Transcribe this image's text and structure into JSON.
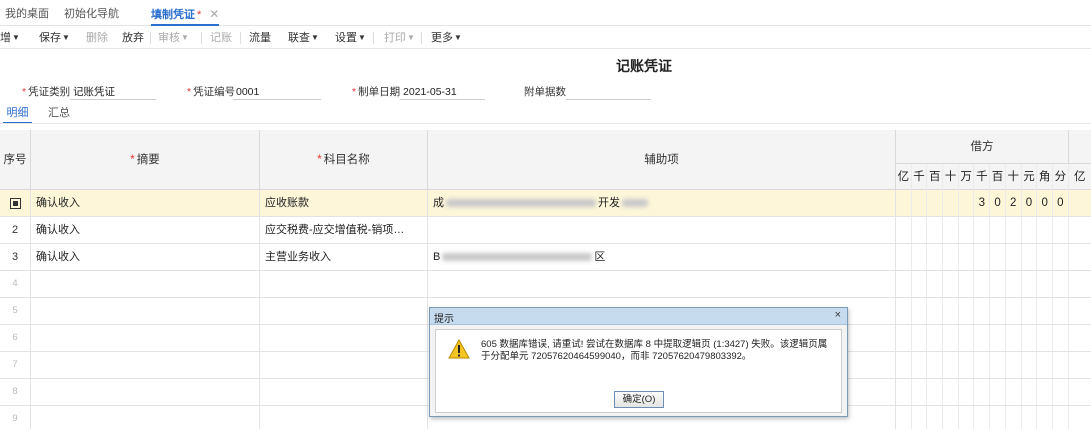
{
  "tabs": [
    {
      "label": "我的桌面"
    },
    {
      "label": "初始化导航"
    },
    {
      "label": "填制凭证",
      "modified": "*",
      "close": "✕"
    }
  ],
  "toolbar": {
    "add": "增",
    "save": "保存",
    "delete": "删除",
    "discard": "放弃",
    "review": "审核",
    "post": "记账",
    "flow": "流量",
    "linked": "联查",
    "settings": "设置",
    "print": "打印",
    "more": "更多"
  },
  "voucher": {
    "title": "记账凭证",
    "type_label": "凭证类别",
    "type_value": "记账凭证",
    "number_label": "凭证编号",
    "number_value": "0001",
    "date_label": "制单日期",
    "date_value": "2021-05-31",
    "attach_label": "附单据数",
    "attach_value": ""
  },
  "subtabs": {
    "detail": "明细",
    "summary": "汇总"
  },
  "grid": {
    "headers": {
      "seq": "序号",
      "summary": "摘要",
      "account": "科目名称",
      "aux": "辅助项",
      "debit": "借方"
    },
    "units": [
      "亿",
      "千",
      "百",
      "十",
      "万",
      "千",
      "百",
      "十",
      "元",
      "角",
      "分"
    ],
    "next_unit": "亿",
    "rows": [
      {
        "seq": "",
        "summary": "确认收入",
        "account": "应收账款",
        "aux_prefix": "成",
        "aux_suffix": "开发",
        "digits": [
          "",
          "",
          "",
          "",
          "",
          "3",
          "0",
          "2",
          "0",
          "0",
          "0"
        ]
      },
      {
        "seq": "2",
        "summary": "确认收入",
        "account": "应交税费-应交增值税-销项…",
        "aux_prefix": "",
        "aux_suffix": "",
        "digits": []
      },
      {
        "seq": "3",
        "summary": "确认收入",
        "account": "主营业务收入",
        "aux_prefix": "B",
        "aux_suffix": "区",
        "digits": []
      },
      {
        "seq": "4"
      },
      {
        "seq": "5"
      },
      {
        "seq": "6"
      },
      {
        "seq": "7"
      },
      {
        "seq": "8"
      },
      {
        "seq": "9"
      }
    ]
  },
  "dialog": {
    "title": "提示",
    "close": "×",
    "message": "605 数据库错误, 请重试! 尝试在数据库 8 中提取逻辑页 (1:3427) 失败。该逻辑页属于分配单元 72057620464599040，而非 72057620479803392。",
    "ok_label": "确定(O)"
  },
  "colors": {
    "accent": "#2a6ecf",
    "selected_row": "#fdf6d9",
    "required": "#e33333",
    "dialog_title": "#c7dbef"
  }
}
